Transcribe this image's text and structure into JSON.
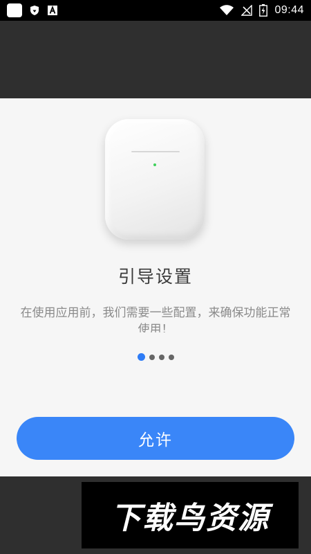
{
  "status_bar": {
    "time": "09:44",
    "left_icons": [
      "app-square-icon",
      "shield-icon",
      "font-a-icon"
    ],
    "right_icons": [
      "wifi-icon",
      "no-signal-icon",
      "battery-charging-icon"
    ]
  },
  "card": {
    "title": "引导设置",
    "description": "在使用应用前，我们需要一些配置，来确保功能正常使用！",
    "pager": {
      "total": 4,
      "active_index": 0
    },
    "allow_button": "允许"
  },
  "watermark": "下载鸟资源",
  "colors": {
    "accent": "#3a86f8",
    "active_dot": "#2e7cf6",
    "led": "#3fd05a",
    "card_bg": "#f6f6f6",
    "overlay": "#2f2f2f"
  }
}
